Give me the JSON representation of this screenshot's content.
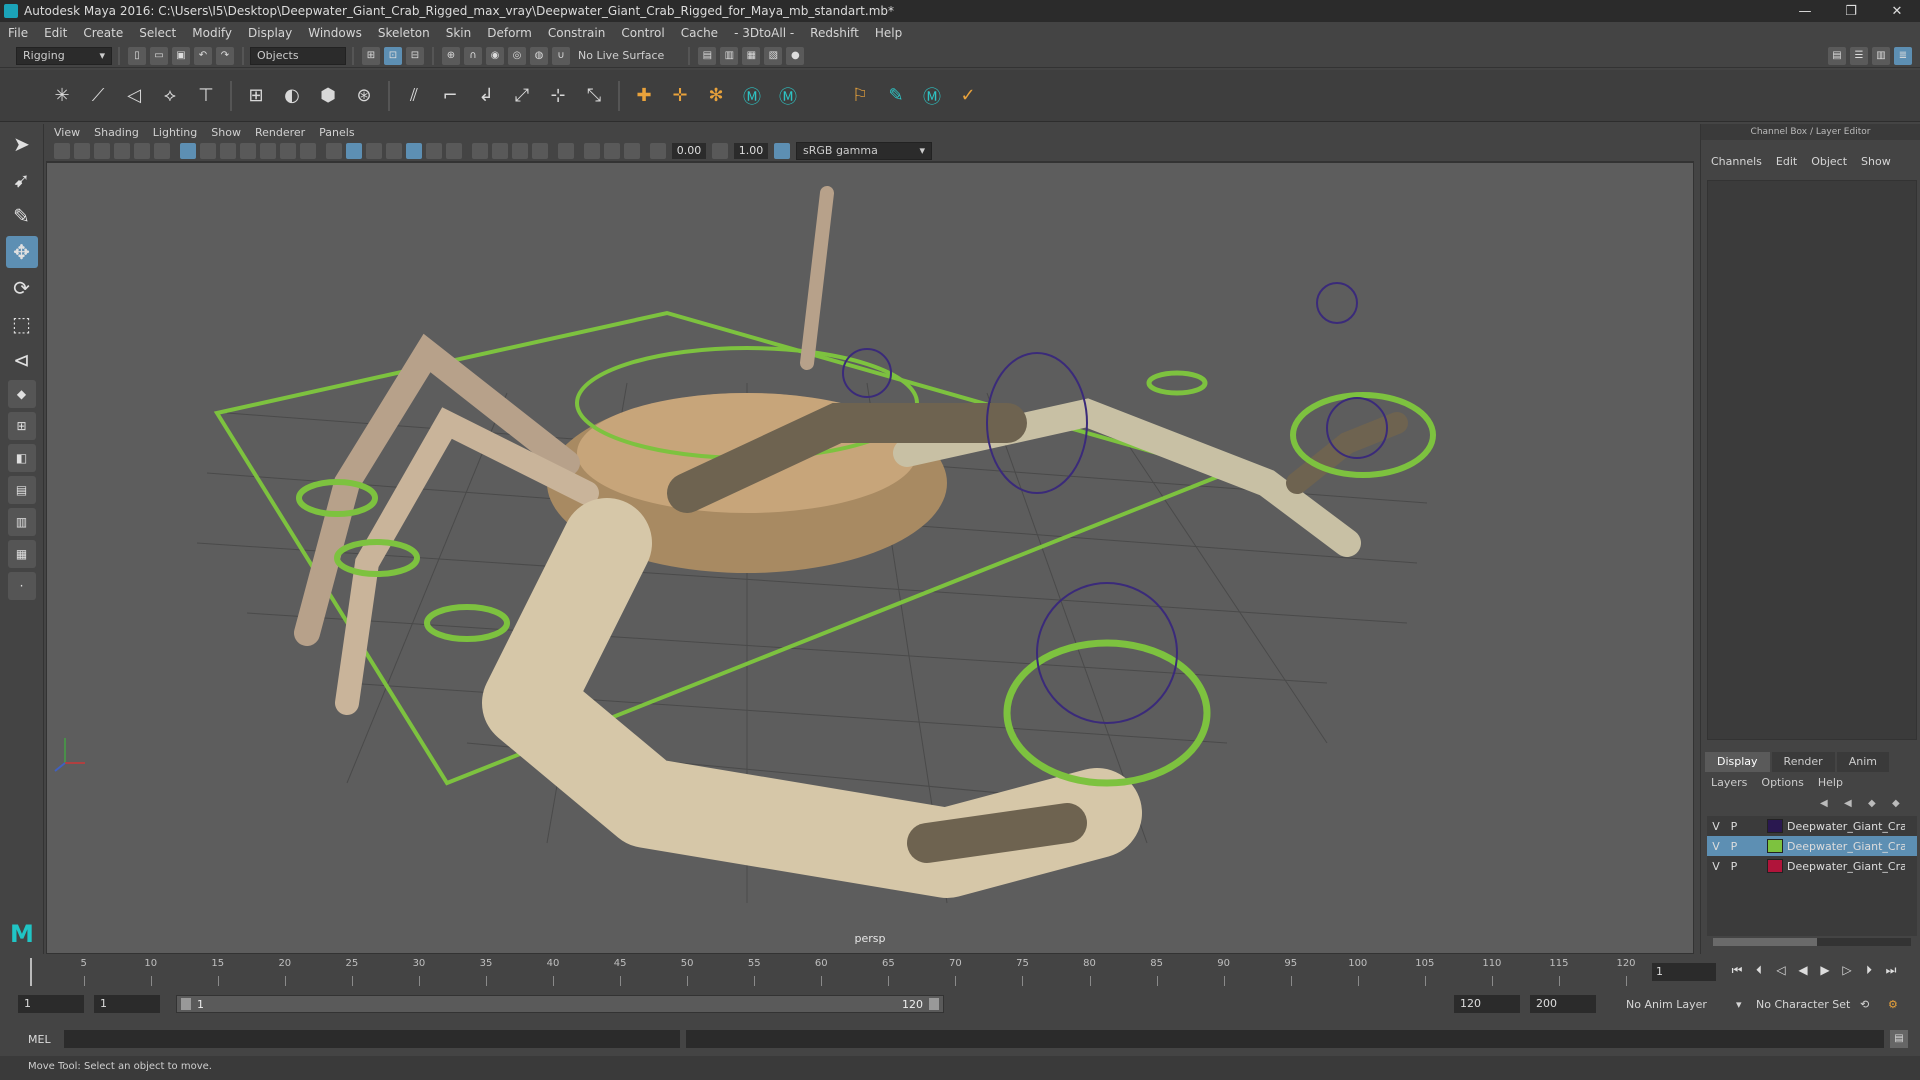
{
  "window": {
    "title": "Autodesk Maya 2016: C:\\Users\\I5\\Desktop\\Deepwater_Giant_Crab_Rigged_max_vray\\Deepwater_Giant_Crab_Rigged_for_Maya_mb_standart.mb*",
    "minimize": "—",
    "restore": "❐",
    "close": "✕"
  },
  "menubar": [
    "File",
    "Edit",
    "Create",
    "Select",
    "Modify",
    "Display",
    "Windows",
    "Skeleton",
    "Skin",
    "Deform",
    "Constrain",
    "Control",
    "Cache",
    "- 3DtoAll -",
    "Redshift",
    "Help"
  ],
  "statusline": {
    "menuset": "Rigging",
    "select_mode": "Objects",
    "live_surface": "No Live Surface"
  },
  "viewport": {
    "menus": [
      "View",
      "Shading",
      "Lighting",
      "Show",
      "Renderer",
      "Panels"
    ],
    "exposure": "0.00",
    "gamma": "1.00",
    "color_space": "sRGB gamma",
    "camera": "persp"
  },
  "channel_box": {
    "header": "Channel Box / Layer Editor",
    "menus": [
      "Channels",
      "Edit",
      "Object",
      "Show"
    ],
    "tabs": [
      "Display",
      "Render",
      "Anim"
    ],
    "active_tab": "Display",
    "layer_menus": [
      "Layers",
      "Options",
      "Help"
    ],
    "layers": [
      {
        "v": "V",
        "p": "P",
        "name": "Deepwater_Giant_Crab",
        "color": "#2a1850",
        "selected": false
      },
      {
        "v": "V",
        "p": "P",
        "name": "Deepwater_Giant_Crab",
        "color": "#7dc23f",
        "selected": true
      },
      {
        "v": "V",
        "p": "P",
        "name": "Deepwater_Giant_Crab",
        "color": "#b0143a",
        "selected": false
      }
    ]
  },
  "timeline": {
    "ticks": [
      1,
      5,
      10,
      15,
      20,
      25,
      30,
      35,
      40,
      45,
      50,
      55,
      60,
      65,
      70,
      75,
      80,
      85,
      90,
      95,
      100,
      105,
      110,
      115,
      120
    ],
    "current_frame": "1"
  },
  "range": {
    "start": "1",
    "playback_start": "1",
    "slider_start": "1",
    "slider_end": "120",
    "playback_end": "120",
    "end": "200",
    "anim_layer": "No Anim Layer",
    "character_set": "No Character Set"
  },
  "command": {
    "language": "MEL"
  },
  "help_line": "Move Tool: Select an object to move.",
  "colors": {
    "accent": "#5d8fb3",
    "rig_green": "#7dc23f",
    "rig_purple": "#3a2a7a"
  }
}
